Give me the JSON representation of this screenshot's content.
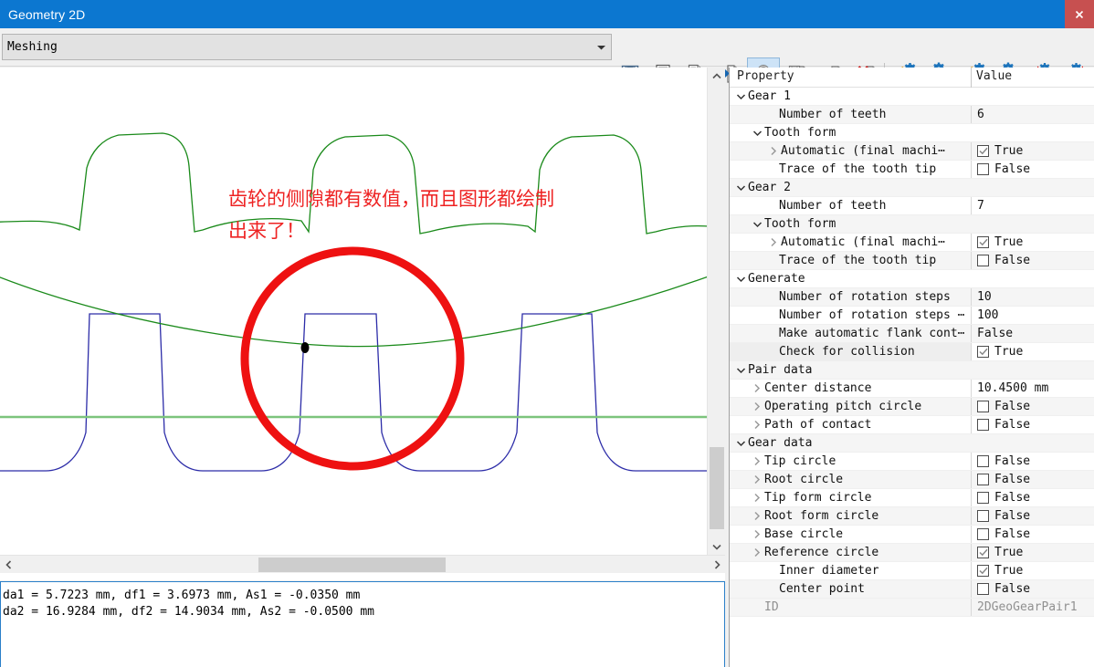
{
  "window": {
    "title": "Geometry 2D",
    "close_label": "x"
  },
  "toolbar": {
    "combo_value": "Meshing",
    "combo_arrow_icon": "chevron-down-icon",
    "buttons": [
      {
        "name": "save-button",
        "icon": "floppy-disk-icon"
      },
      {
        "name": "print-button",
        "icon": "printer-icon"
      },
      {
        "name": "print-preview-button",
        "icon": "document-preview-icon"
      },
      {
        "name": "export-button",
        "icon": "document-export-icon"
      },
      {
        "name": "settings-tool-button",
        "icon": "wrench-icon"
      },
      {
        "name": "save-as-button",
        "icon": "save-document-icon"
      },
      {
        "name": "import-button",
        "icon": "document-import-icon"
      },
      {
        "name": "delete-button",
        "icon": "document-delete-icon"
      },
      {
        "name": "gear-pair-rotate-left-button",
        "icon": "gear-pair-rotate-left-icon"
      },
      {
        "name": "gear-pair-rotate-right-button",
        "icon": "gear-pair-rotate-right-icon"
      },
      {
        "name": "gear-pair-rotate-gear1-button",
        "icon": "gear-pair-rotate-gear1-icon"
      },
      {
        "name": "gear-pair-rotate-gear2-button",
        "icon": "gear-pair-rotate-gear2-icon"
      },
      {
        "name": "gear-pair-center-in-button",
        "icon": "gear-pair-center-in-icon"
      },
      {
        "name": "gear-pair-center-out-button",
        "icon": "gear-pair-center-out-icon"
      }
    ]
  },
  "drawing": {
    "annotation_text": "齿轮的侧隙都有数值，而且图形都绘制\n出来了！",
    "annotation_color": "#ee2222",
    "highlight_circle_color": "#ee1111",
    "gear1_curve_color": "#2c2ca8",
    "gear2_curve_color": "#1a8a1a",
    "reference_line_color": "#7cc47c",
    "contact_point_color": "#000000"
  },
  "status": {
    "line1": "da1 = 5.7223 mm, df1 = 3.6973 mm, As1 = -0.0350 mm",
    "line2": "da2 = 16.9284 mm, df2 = 14.9034 mm, As2 = -0.0500 mm"
  },
  "scrollbars": {
    "v_up_icon": "chevron-up-icon",
    "v_down_icon": "chevron-down-icon",
    "h_left_icon": "chevron-left-icon",
    "h_right_icon": "chevron-right-icon"
  },
  "properties": {
    "header": {
      "property": "Property",
      "value": "Value"
    },
    "rows": [
      {
        "name": "group-gear-1",
        "label": "Gear 1",
        "indent": 0,
        "twisty": "expanded",
        "value_type": "none",
        "value": "",
        "shade": "white"
      },
      {
        "name": "gear1-number-of-teeth",
        "label": "Number of teeth",
        "indent": 1,
        "twisty": "none",
        "value_type": "text",
        "value": "6",
        "shade": "alt"
      },
      {
        "name": "gear1-tooth-form-group",
        "label": "Tooth form",
        "indent": 0,
        "twisty": "expanded-i1",
        "value_type": "none",
        "value": "",
        "shade": "white"
      },
      {
        "name": "gear1-automatic-final",
        "label": "Automatic (final machi⋯",
        "indent": 1,
        "twisty": "collapsed-i2",
        "value_type": "checkbox",
        "value": "True",
        "checked": true,
        "shade": "alt"
      },
      {
        "name": "gear1-trace-tooth-tip",
        "label": "Trace of the tooth tip",
        "indent": 1,
        "twisty": "none",
        "value_type": "checkbox",
        "value": "False",
        "checked": false,
        "shade": "white"
      },
      {
        "name": "group-gear-2",
        "label": "Gear 2",
        "indent": 0,
        "twisty": "expanded",
        "value_type": "none",
        "value": "",
        "shade": "alt"
      },
      {
        "name": "gear2-number-of-teeth",
        "label": "Number of teeth",
        "indent": 1,
        "twisty": "none",
        "value_type": "text",
        "value": "7",
        "shade": "white"
      },
      {
        "name": "gear2-tooth-form-group",
        "label": "Tooth form",
        "indent": 0,
        "twisty": "expanded-i1",
        "value_type": "none",
        "value": "",
        "shade": "alt"
      },
      {
        "name": "gear2-automatic-final",
        "label": "Automatic (final machi⋯",
        "indent": 1,
        "twisty": "collapsed-i2",
        "value_type": "checkbox",
        "value": "True",
        "checked": true,
        "shade": "white"
      },
      {
        "name": "gear2-trace-tooth-tip",
        "label": "Trace of the tooth tip",
        "indent": 1,
        "twisty": "none",
        "value_type": "checkbox",
        "value": "False",
        "checked": false,
        "shade": "alt"
      },
      {
        "name": "group-generate",
        "label": "Generate",
        "indent": 0,
        "twisty": "expanded",
        "value_type": "none",
        "value": "",
        "shade": "white"
      },
      {
        "name": "number-of-rotation-steps",
        "label": "Number of rotation steps",
        "indent": 1,
        "twisty": "none",
        "value_type": "text",
        "value": "10",
        "shade": "alt"
      },
      {
        "name": "number-of-rotation-steps-2",
        "label": "Number of rotation steps ⋯",
        "indent": 1,
        "twisty": "none",
        "value_type": "text",
        "value": "100",
        "shade": "white"
      },
      {
        "name": "make-automatic-flank-cont",
        "label": "Make automatic flank cont⋯",
        "indent": 1,
        "twisty": "none",
        "value_type": "text",
        "value": "False",
        "shade": "alt"
      },
      {
        "name": "check-for-collision",
        "label": "Check for collision",
        "indent": 1,
        "twisty": "none",
        "value_type": "checkbox",
        "value": "True",
        "checked": true,
        "shade": "sel"
      },
      {
        "name": "group-pair-data",
        "label": "Pair data",
        "indent": 0,
        "twisty": "expanded",
        "value_type": "none",
        "value": "",
        "shade": "alt"
      },
      {
        "name": "center-distance",
        "label": "Center distance",
        "indent": 0,
        "twisty": "collapsed-i1",
        "value_type": "text",
        "value": "10.4500 mm",
        "shade": "white"
      },
      {
        "name": "operating-pitch-circle",
        "label": "Operating pitch circle",
        "indent": 0,
        "twisty": "collapsed-i1",
        "value_type": "checkbox",
        "value": "False",
        "checked": false,
        "shade": "alt"
      },
      {
        "name": "path-of-contact",
        "label": "Path of contact",
        "indent": 0,
        "twisty": "collapsed-i1",
        "value_type": "checkbox",
        "value": "False",
        "checked": false,
        "shade": "white"
      },
      {
        "name": "group-gear-data",
        "label": "Gear data",
        "indent": 0,
        "twisty": "expanded",
        "value_type": "none",
        "value": "",
        "shade": "alt"
      },
      {
        "name": "tip-circle",
        "label": "Tip circle",
        "indent": 0,
        "twisty": "collapsed-i1",
        "value_type": "checkbox",
        "value": "False",
        "checked": false,
        "shade": "white"
      },
      {
        "name": "root-circle",
        "label": "Root circle",
        "indent": 0,
        "twisty": "collapsed-i1",
        "value_type": "checkbox",
        "value": "False",
        "checked": false,
        "shade": "alt"
      },
      {
        "name": "tip-form-circle",
        "label": "Tip form circle",
        "indent": 0,
        "twisty": "collapsed-i1",
        "value_type": "checkbox",
        "value": "False",
        "checked": false,
        "shade": "white"
      },
      {
        "name": "root-form-circle",
        "label": "Root form circle",
        "indent": 0,
        "twisty": "collapsed-i1",
        "value_type": "checkbox",
        "value": "False",
        "checked": false,
        "shade": "alt"
      },
      {
        "name": "base-circle",
        "label": "Base circle",
        "indent": 0,
        "twisty": "collapsed-i1",
        "value_type": "checkbox",
        "value": "False",
        "checked": false,
        "shade": "white"
      },
      {
        "name": "reference-circle",
        "label": "Reference circle",
        "indent": 0,
        "twisty": "collapsed-i1",
        "value_type": "checkbox",
        "value": "True",
        "checked": true,
        "shade": "alt"
      },
      {
        "name": "inner-diameter",
        "label": "Inner diameter",
        "indent": 1,
        "twisty": "none",
        "value_type": "checkbox",
        "value": "True",
        "checked": true,
        "shade": "white"
      },
      {
        "name": "center-point",
        "label": "Center point",
        "indent": 1,
        "twisty": "none",
        "value_type": "checkbox",
        "value": "False",
        "checked": false,
        "shade": "alt"
      },
      {
        "name": "id-row",
        "label": "ID",
        "indent": 1,
        "twisty": "none",
        "value_type": "idtext",
        "value": "2DGeoGearPair1",
        "shade": "id"
      }
    ]
  }
}
